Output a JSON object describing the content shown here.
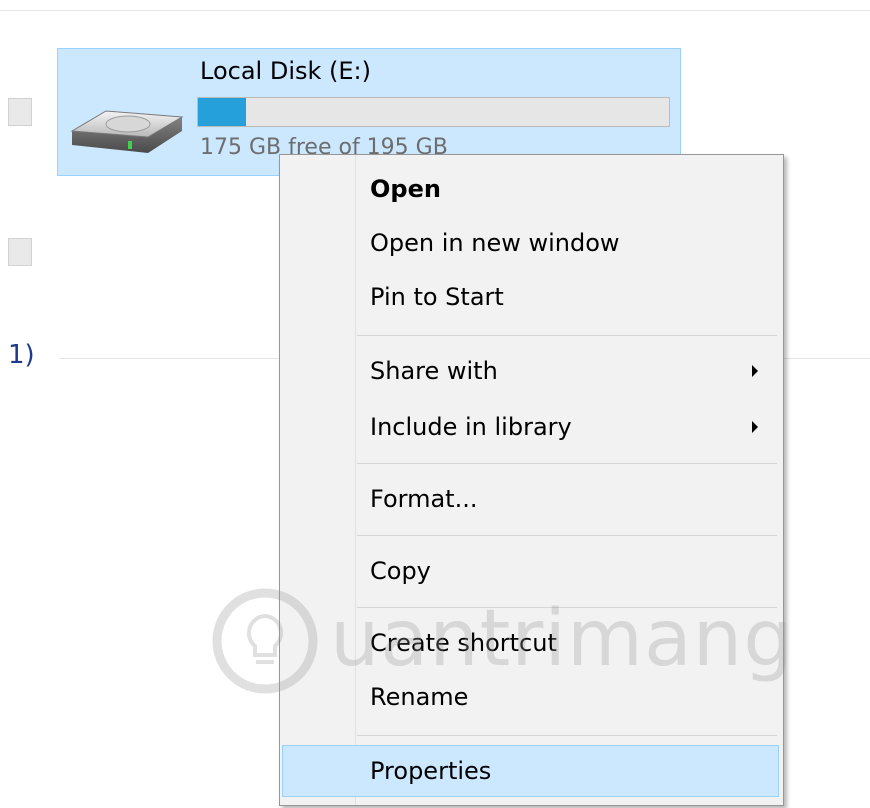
{
  "drive": {
    "name": "Local Disk (E:)",
    "free_text": "175 GB free of 195 GB",
    "used_fraction": 0.1026,
    "usage_color": "#26a0da"
  },
  "group": {
    "label": "1)"
  },
  "context_menu": {
    "items": [
      {
        "label": "Open"
      },
      {
        "label": "Open in new window"
      },
      {
        "label": "Pin to Start"
      },
      {
        "label": "Share with"
      },
      {
        "label": "Include in library"
      },
      {
        "label": "Format..."
      },
      {
        "label": "Copy"
      },
      {
        "label": "Create shortcut"
      },
      {
        "label": "Rename"
      },
      {
        "label": "Properties"
      }
    ]
  },
  "watermark": {
    "text": "uantrimang",
    "icon": "lightbulb-icon"
  },
  "colors": {
    "selection": "#cce8ff",
    "selection_border": "#99d1ff",
    "menu_bg": "#f2f2f2"
  }
}
